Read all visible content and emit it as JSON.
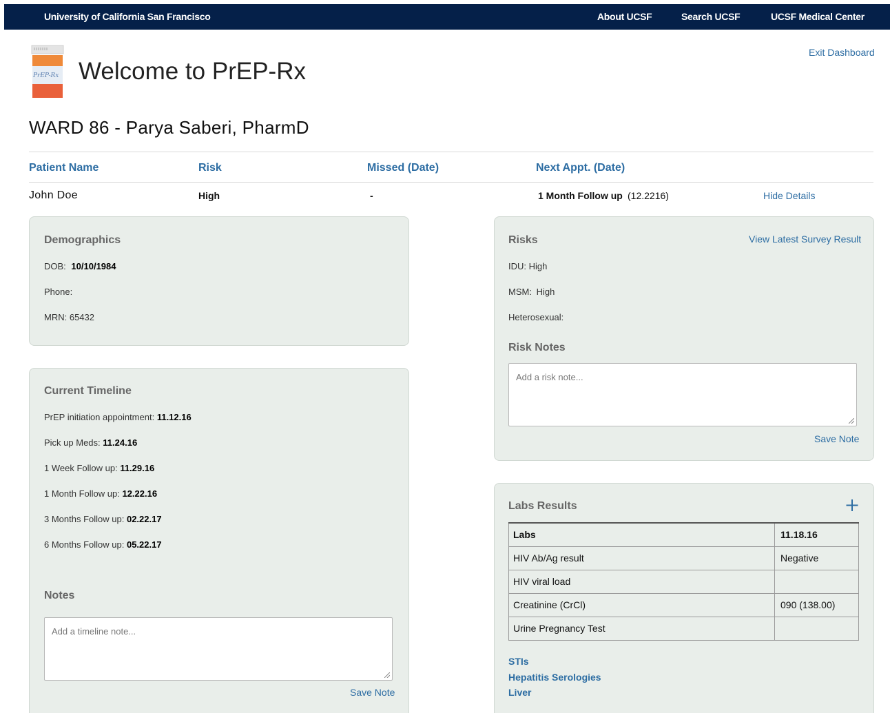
{
  "topbar": {
    "brand": "University of California San Francisco",
    "nav": [
      "About UCSF",
      "Search UCSF",
      "UCSF Medical Center"
    ]
  },
  "logo": {
    "icon": "pill-bottle-icon",
    "label": "PrEP-Rx"
  },
  "header": {
    "title": "Welcome to PrEP-Rx",
    "exit_label": "Exit Dashboard"
  },
  "clinic": {
    "heading": "WARD 86 - Parya Saberi, PharmD"
  },
  "patients": {
    "columns": [
      "Patient Name",
      "Risk",
      "Missed (Date)",
      "Next Appt. (Date)"
    ],
    "row": {
      "name": "John Doe",
      "risk": "High",
      "missed": "-",
      "next_appt": "1 Month Follow up",
      "next_appt_date": "(12.2216)",
      "toggle_label": "Hide Details"
    }
  },
  "demographics": {
    "title": "Demographics",
    "dob_label": "DOB:",
    "dob": "10/10/1984",
    "phone_label": "Phone:",
    "phone": "",
    "mrn_label": "MRN:",
    "mrn": "65432"
  },
  "timeline": {
    "title": "Current Timeline",
    "items": [
      {
        "label": "PrEP initiation appointment:",
        "date": "11.12.16"
      },
      {
        "label": "Pick up Meds:",
        "date": "11.24.16"
      },
      {
        "label": "1 Week Follow up:",
        "date": "11.29.16"
      },
      {
        "label": "1 Month Follow up:",
        "date": "12.22.16"
      },
      {
        "label": "3 Months Follow up:",
        "date": "02.22.17"
      },
      {
        "label": "6 Months Follow up:",
        "date": "05.22.17"
      }
    ],
    "notes_title": "Notes",
    "notes_placeholder": "Add a timeline note...",
    "save_label": "Save Note"
  },
  "risks": {
    "title": "Risks",
    "survey_link": "View Latest Survey Result",
    "items": [
      {
        "label": "IDU:",
        "value": "High"
      },
      {
        "label": "MSM:",
        "value": "High"
      },
      {
        "label": "Heterosexual:",
        "value": ""
      }
    ],
    "notes_title": "Risk Notes",
    "notes_placeholder": "Add a risk note...",
    "save_label": "Save Note"
  },
  "labs": {
    "title": "Labs Results",
    "add_icon": "plus-icon",
    "header": {
      "label": "Labs",
      "date": "11.18.16"
    },
    "rows": [
      {
        "label": "HIV Ab/Ag result",
        "value": "Negative"
      },
      {
        "label": "HIV viral load",
        "value": ""
      },
      {
        "label": "Creatinine (CrCl)",
        "value": "090 (138.00)"
      },
      {
        "label": "Urine Pregnancy Test",
        "value": ""
      }
    ],
    "sections": [
      "STIs",
      "Hepatitis Serologies",
      "Liver"
    ]
  }
}
